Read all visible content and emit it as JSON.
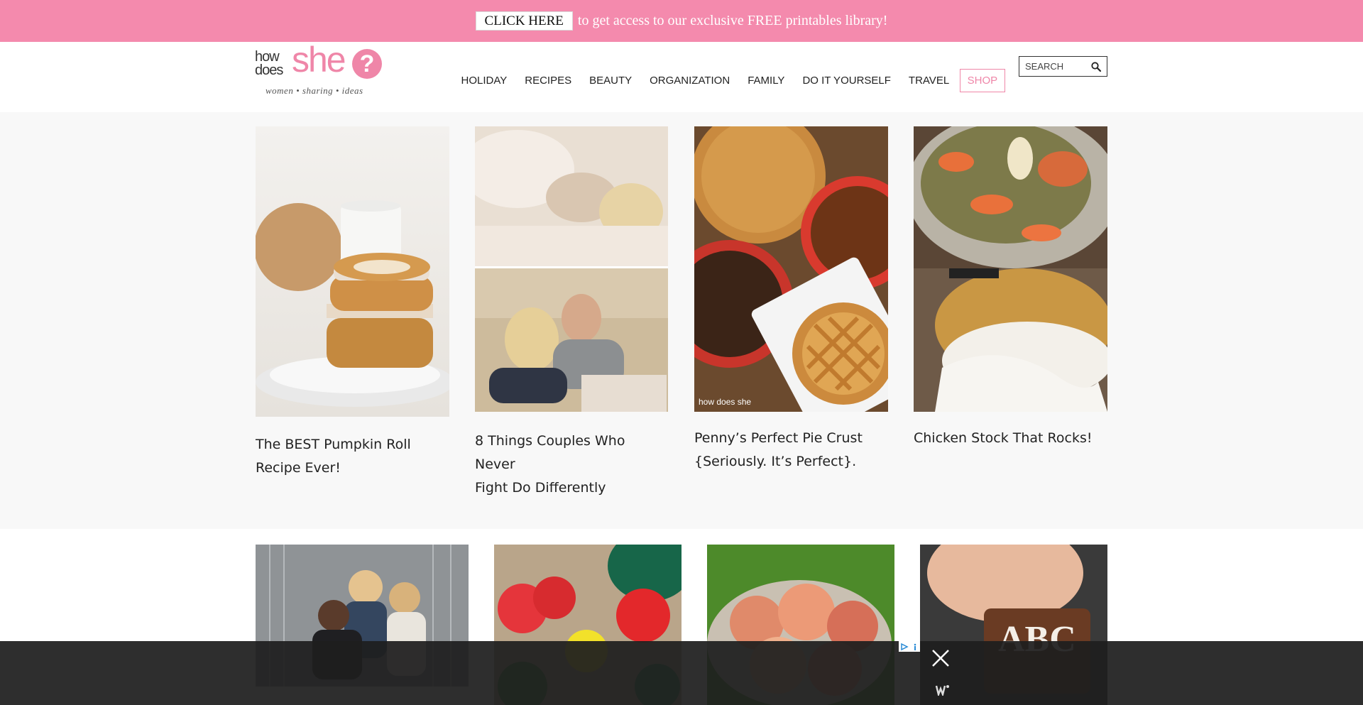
{
  "promo": {
    "button_label": "CLICK HERE",
    "text": "to get access to our exclusive FREE printables library!"
  },
  "logo": {
    "line1": "how",
    "line2": "does",
    "brand": "she",
    "mark": "?",
    "tagline": "women • sharing • ideas"
  },
  "nav": {
    "items": [
      "HOLIDAY",
      "RECIPES",
      "BEAUTY",
      "ORGANIZATION",
      "FAMILY",
      "DO IT YOURSELF",
      "TRAVEL"
    ],
    "shop_label": "SHOP"
  },
  "search": {
    "placeholder": "SEARCH"
  },
  "posts": [
    {
      "title_line1": "The BEST Pumpkin Roll",
      "title_line2": "Recipe Ever!"
    },
    {
      "title_line1": "8 Things Couples Who Never",
      "title_line2": "Fight Do Differently"
    },
    {
      "title_line1": "Penny’s Perfect Pie Crust",
      "title_line2": "{Seriously. It’s Perfect}."
    },
    {
      "title_line1": "Chicken Stock That Rocks!",
      "title_line2": ""
    }
  ],
  "image_watermark": "how does she",
  "colors": {
    "accent": "#f48aad",
    "brand_pink": "#ef86a8"
  }
}
